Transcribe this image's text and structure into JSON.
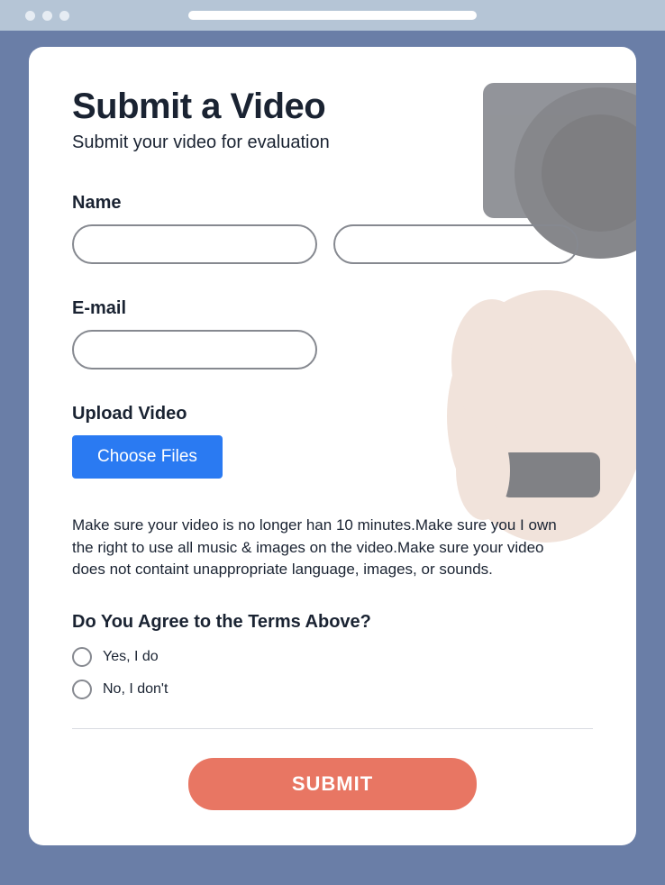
{
  "header": {
    "title": "Submit a Video",
    "subtitle": "Submit your video for evaluation"
  },
  "fields": {
    "name_label": "Name",
    "email_label": "E-mail",
    "upload_label": "Upload Video",
    "choose_files_label": "Choose Files"
  },
  "terms": {
    "text": "Make sure your video is no longer  han 10 minutes.Make sure you I own the right to use all music & images on the video.Make sure your video does not containt unappropriate language, images, or sounds."
  },
  "agree": {
    "question": "Do You Agree to the Terms Above?",
    "options": [
      "Yes, I do",
      "No, I don't"
    ]
  },
  "submit_label": "SUBMIT"
}
